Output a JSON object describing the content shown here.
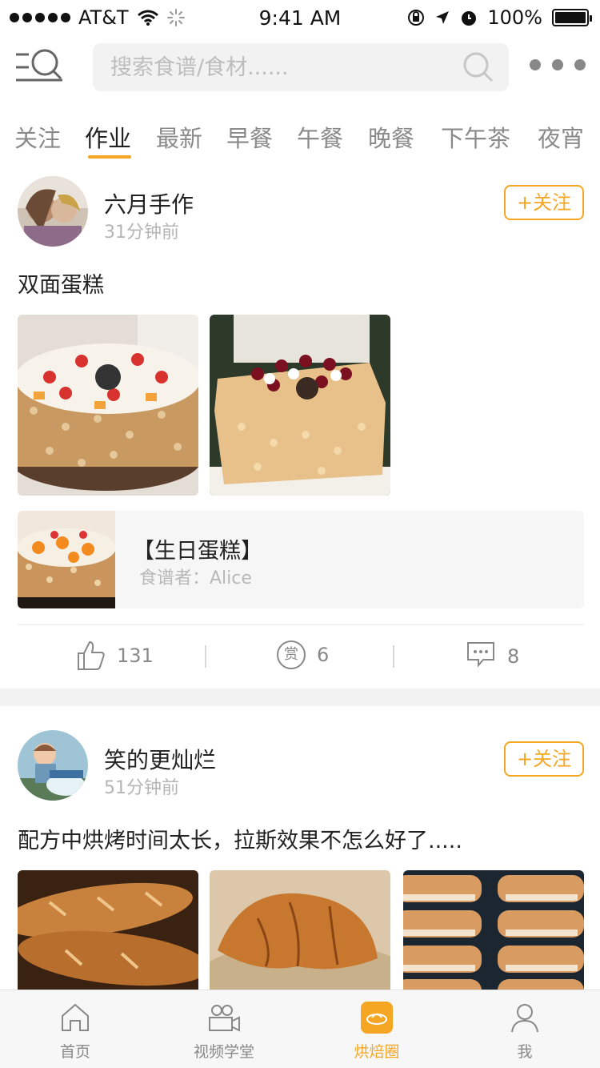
{
  "status_bar": {
    "carrier": "AT&T",
    "time": "9:41 AM",
    "battery": "100%"
  },
  "header": {
    "search_placeholder": "搜索食谱/食材......"
  },
  "tabs": [
    {
      "label": "关注"
    },
    {
      "label": "作业"
    },
    {
      "label": "最新"
    },
    {
      "label": "早餐"
    },
    {
      "label": "午餐"
    },
    {
      "label": "晚餐"
    },
    {
      "label": "下午茶"
    },
    {
      "label": "夜宵"
    }
  ],
  "active_tab": "作业",
  "posts": [
    {
      "user": "六月手作",
      "time": "31分钟前",
      "follow_label": "+关注",
      "text": "双面蛋糕",
      "recipe": {
        "title": "【生日蛋糕】",
        "author": "食谱者：Alice"
      },
      "likes": "131",
      "reward_icon_text": "赏",
      "rewards": "6",
      "comments": "8"
    },
    {
      "user": "笑的更灿烂",
      "time": "51分钟前",
      "follow_label": "+关注",
      "text": "配方中烘烤时间太长，拉斯效果不怎么好了....."
    }
  ],
  "tabbar": [
    {
      "label": "首页",
      "icon": "home-icon"
    },
    {
      "label": "视频学堂",
      "icon": "video-icon"
    },
    {
      "label": "烘焙圈",
      "icon": "baking-circle-icon",
      "active": true
    },
    {
      "label": "我",
      "icon": "user-icon"
    }
  ],
  "colors": {
    "accent": "#f5a623",
    "muted": "#8a8a8a",
    "background_gap": "#f2f2f2"
  }
}
